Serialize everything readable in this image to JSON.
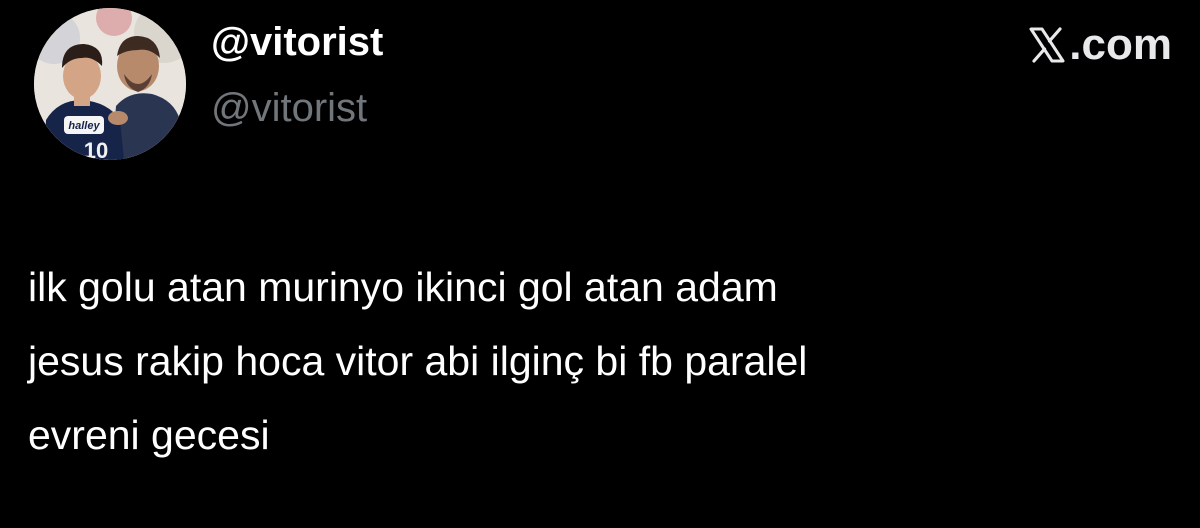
{
  "author": {
    "display_name": "@vitorist",
    "handle": "@vitorist",
    "avatar": "profile-photo-icon"
  },
  "brand": {
    "text": ".com",
    "logo": "x-logo-icon"
  },
  "tweet": {
    "lines": [
      "ilk golu atan murinyo ikinci gol atan adam",
      "jesus rakip hoca vitor abi ilginç bi fb paralel",
      "evreni gecesi"
    ]
  },
  "colors": {
    "background": "#000000",
    "text": "#ffffff",
    "secondary_text": "#71767b"
  }
}
